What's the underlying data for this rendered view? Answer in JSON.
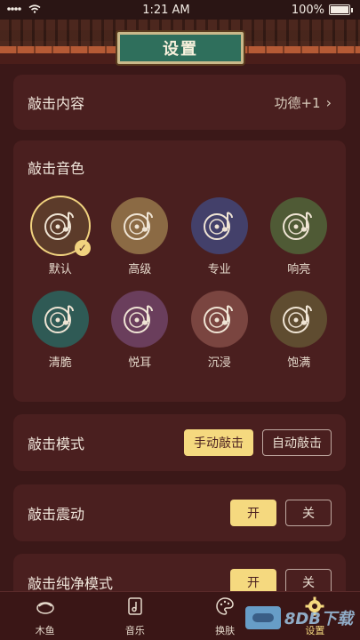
{
  "status_bar": {
    "time": "1:21 AM",
    "battery": "100%"
  },
  "header": {
    "title": "设置"
  },
  "content_row": {
    "label": "敲击内容",
    "value": "功德+1",
    "chevron": "›"
  },
  "sound_section": {
    "title": "敲击音色",
    "selected_index": 0,
    "items": [
      {
        "name": "默认",
        "color": "#5c3b2a"
      },
      {
        "name": "高级",
        "color": "#8b6a44"
      },
      {
        "name": "专业",
        "color": "#43406a"
      },
      {
        "name": "响亮",
        "color": "#4f5a35"
      },
      {
        "name": "清脆",
        "color": "#2f5a55"
      },
      {
        "name": "悦耳",
        "color": "#6a3e5c"
      },
      {
        "name": "沉浸",
        "color": "#7a4540"
      },
      {
        "name": "饱满",
        "color": "#5f4c30"
      }
    ]
  },
  "mode_row": {
    "label": "敲击模式",
    "options": [
      "手动敲击",
      "自动敲击"
    ],
    "selected": 0
  },
  "vibration_row": {
    "label": "敲击震动",
    "on_label": "开",
    "off_label": "关",
    "selected": "on"
  },
  "pure_row": {
    "label": "敲击纯净模式",
    "on_label": "开",
    "off_label": "关",
    "selected": "on"
  },
  "tabbar": {
    "tabs": [
      {
        "label": "木鱼",
        "icon": "wooden-fish-icon"
      },
      {
        "label": "音乐",
        "icon": "music-file-icon"
      },
      {
        "label": "换肤",
        "icon": "palette-icon"
      },
      {
        "label": "设置",
        "icon": "gear-icon"
      }
    ],
    "active_index": 3
  },
  "watermark": {
    "text": "8DB下载"
  }
}
